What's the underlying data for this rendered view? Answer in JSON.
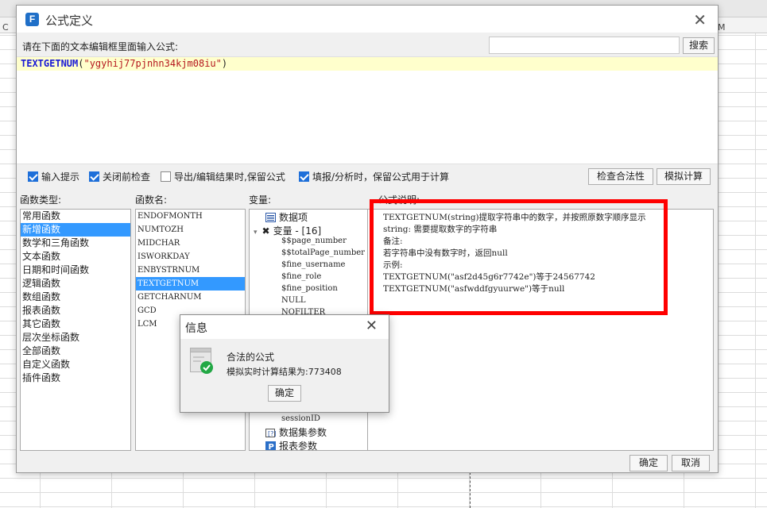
{
  "background": {
    "column_labels": [
      "C",
      "M"
    ]
  },
  "dialog": {
    "title": "公式定义",
    "prompt": "请在下面的文本编辑框里面输入公式:",
    "search_placeholder": "",
    "search_button": "搜索",
    "formula": {
      "function": "TEXTGETNUM",
      "open": "(",
      "argument": "\"ygyhij77pjnhn34kjm08iu\"",
      "close": ")"
    },
    "options": [
      {
        "label": "输入提示",
        "checked": true
      },
      {
        "label": "关闭前检查",
        "checked": true
      },
      {
        "label": "导出/编辑结果时,保留公式",
        "checked": false
      },
      {
        "label": "填报/分析时，保留公式用于计算",
        "checked": true
      }
    ],
    "check_button": "检查合法性",
    "simulate_button": "模拟计算",
    "labels": {
      "function_types": "函数类型:",
      "function_names": "函数名:",
      "variables": "变量:",
      "description": "公式说明:"
    },
    "function_types": [
      {
        "label": "常用函数",
        "selected": false
      },
      {
        "label": "新增函数",
        "selected": true
      },
      {
        "label": "数学和三角函数",
        "selected": false
      },
      {
        "label": "文本函数",
        "selected": false
      },
      {
        "label": "日期和时间函数",
        "selected": false
      },
      {
        "label": "逻辑函数",
        "selected": false
      },
      {
        "label": "数组函数",
        "selected": false
      },
      {
        "label": "报表函数",
        "selected": false
      },
      {
        "label": "其它函数",
        "selected": false
      },
      {
        "label": "层次坐标函数",
        "selected": false
      },
      {
        "label": "全部函数",
        "selected": false
      },
      {
        "label": "自定义函数",
        "selected": false
      },
      {
        "label": "插件函数",
        "selected": false
      }
    ],
    "function_names": [
      {
        "label": "ENDOFMONTH",
        "selected": false
      },
      {
        "label": "NUMTOZH",
        "selected": false
      },
      {
        "label": "MIDCHAR",
        "selected": false
      },
      {
        "label": "ISWORKDAY",
        "selected": false
      },
      {
        "label": "ENBYSTRNUM",
        "selected": false
      },
      {
        "label": "TEXTGETNUM",
        "selected": true
      },
      {
        "label": "GETCHARNUM",
        "selected": false
      },
      {
        "label": "GCD",
        "selected": false
      },
      {
        "label": "LCM",
        "selected": false
      }
    ],
    "variables": {
      "data_items": "数据项",
      "variable_group": "变量 - [16]",
      "items": [
        "$$page_number",
        "$$totalPage_number",
        "$fine_username",
        "$fine_role",
        "$fine_position",
        "NULL",
        "NOFILTER"
      ],
      "session_id": "sessionID",
      "dataset_params": "数据集参数",
      "report_params": "报表参数"
    },
    "description_lines": [
      "TEXTGETNUM(string)提取字符串中的数字，并按照原数字顺序显示",
      "string: 需要提取数字的字符串",
      "备注:",
      "若字符串中没有数字时，返回null",
      "示例:",
      "TEXTGETNUM(\"asf2d45g6r7742e\")等于24567742",
      "TEXTGETNUM(\"asfwddfgyuurwe\")等于null"
    ],
    "ok_button": "确定",
    "cancel_button": "取消"
  },
  "info": {
    "title": "信息",
    "message": "合法的公式",
    "result": "模拟实时计算结果为:773408",
    "ok_button": "确定"
  }
}
